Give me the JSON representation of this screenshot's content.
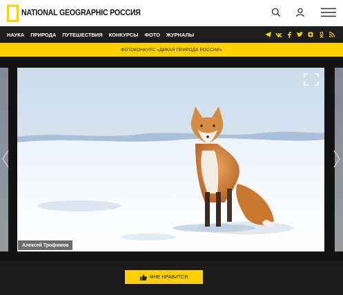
{
  "header": {
    "logo_text": "NATIONAL GEOGRAPHIC РОССИЯ",
    "icons": [
      "search-icon",
      "user-icon",
      "menu-icon"
    ]
  },
  "nav": {
    "items": [
      {
        "label": "НАУКА"
      },
      {
        "label": "ПРИРОДА"
      },
      {
        "label": "ПУТЕШЕСТВИЯ"
      },
      {
        "label": "КОНКУРСЫ"
      },
      {
        "label": "ФОТО"
      },
      {
        "label": "ЖУРНАЛЫ"
      }
    ],
    "social_icons": [
      "telegram-icon",
      "vk-icon",
      "facebook-icon",
      "twitter-icon",
      "instagram-icon",
      "odnoklassniki-icon",
      "rss-icon"
    ]
  },
  "banner": {
    "text": "ФОТОКОНКУРС «ДИКАЯ ПРИРОДА РОССИИ»"
  },
  "slider": {
    "photo_subject": "red fox on snow",
    "credit": "Алексей Трофимов"
  },
  "actions": {
    "like_label": "МНЕ НРАВИТСЯ"
  },
  "colors": {
    "accent": "#ffd100",
    "nav_bg": "#1e1e1e",
    "page_bg": "#141414"
  }
}
